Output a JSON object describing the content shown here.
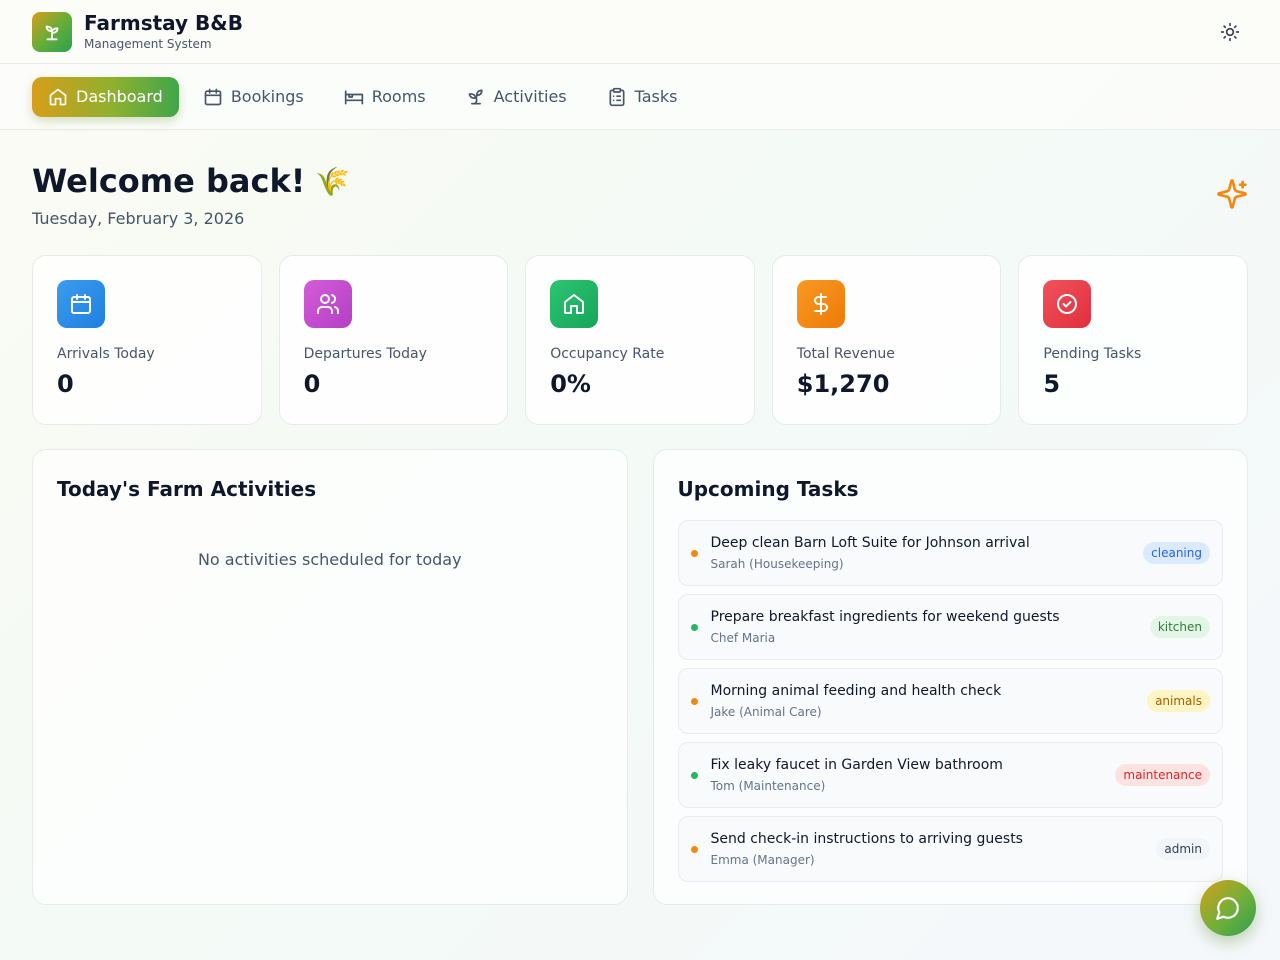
{
  "app": {
    "title": "Farmstay B&B",
    "subtitle": "Management System",
    "logo_icon": "sprout-icon",
    "theme_icon": "sun-icon"
  },
  "nav": {
    "items": [
      {
        "label": "Dashboard",
        "icon": "home-icon",
        "active": true
      },
      {
        "label": "Bookings",
        "icon": "calendar-icon",
        "active": false
      },
      {
        "label": "Rooms",
        "icon": "bed-icon",
        "active": false
      },
      {
        "label": "Activities",
        "icon": "sprout-icon",
        "active": false
      },
      {
        "label": "Tasks",
        "icon": "clipboard-icon",
        "active": false
      }
    ]
  },
  "welcome": {
    "title": "Welcome back!",
    "emoji": "🌾",
    "date": "Tuesday, February 3, 2026"
  },
  "stats": [
    {
      "label": "Arrivals Today",
      "value": "0",
      "icon": "calendar-icon",
      "color": "#2f8fe8"
    },
    {
      "label": "Departures Today",
      "value": "0",
      "icon": "users-icon",
      "color": "#c94fd1"
    },
    {
      "label": "Occupancy Rate",
      "value": "0%",
      "icon": "home-icon",
      "color": "#22b865"
    },
    {
      "label": "Total Revenue",
      "value": "$1,270",
      "icon": "dollar-icon",
      "color": "#f5880f"
    },
    {
      "label": "Pending Tasks",
      "value": "5",
      "icon": "check-circle-icon",
      "color": "#ea3c48"
    }
  ],
  "activities": {
    "title": "Today's Farm Activities",
    "empty_text": "No activities scheduled for today"
  },
  "tasks": {
    "title": "Upcoming Tasks",
    "items": [
      {
        "title": "Deep clean Barn Loft Suite for Johnson arrival",
        "assignee": "Sarah (Housekeeping)",
        "tag": "cleaning",
        "dot": "#f5880f",
        "tag_bg": "#dbeafe",
        "tag_fg": "#2563eb"
      },
      {
        "title": "Prepare breakfast ingredients for weekend guests",
        "assignee": "Chef Maria",
        "tag": "kitchen",
        "dot": "#22b865",
        "tag_bg": "#e3f5e6",
        "tag_fg": "#2f7d3a"
      },
      {
        "title": "Morning animal feeding and health check",
        "assignee": "Jake (Animal Care)",
        "tag": "animals",
        "dot": "#f5880f",
        "tag_bg": "#fdf5c4",
        "tag_fg": "#a16207"
      },
      {
        "title": "Fix leaky faucet in Garden View bathroom",
        "assignee": "Tom (Maintenance)",
        "tag": "maintenance",
        "dot": "#22b865",
        "tag_bg": "#fde2e2",
        "tag_fg": "#dc2626"
      },
      {
        "title": "Send check-in instructions to arriving guests",
        "assignee": "Emma (Manager)",
        "tag": "admin",
        "dot": "#f5880f",
        "tag_bg": "#f1f5f9",
        "tag_fg": "#334155"
      }
    ]
  },
  "fab": {
    "icon": "chat-icon"
  },
  "decor": {
    "sparkle_icon": "sparkles-icon",
    "accent": "#f5880f"
  }
}
